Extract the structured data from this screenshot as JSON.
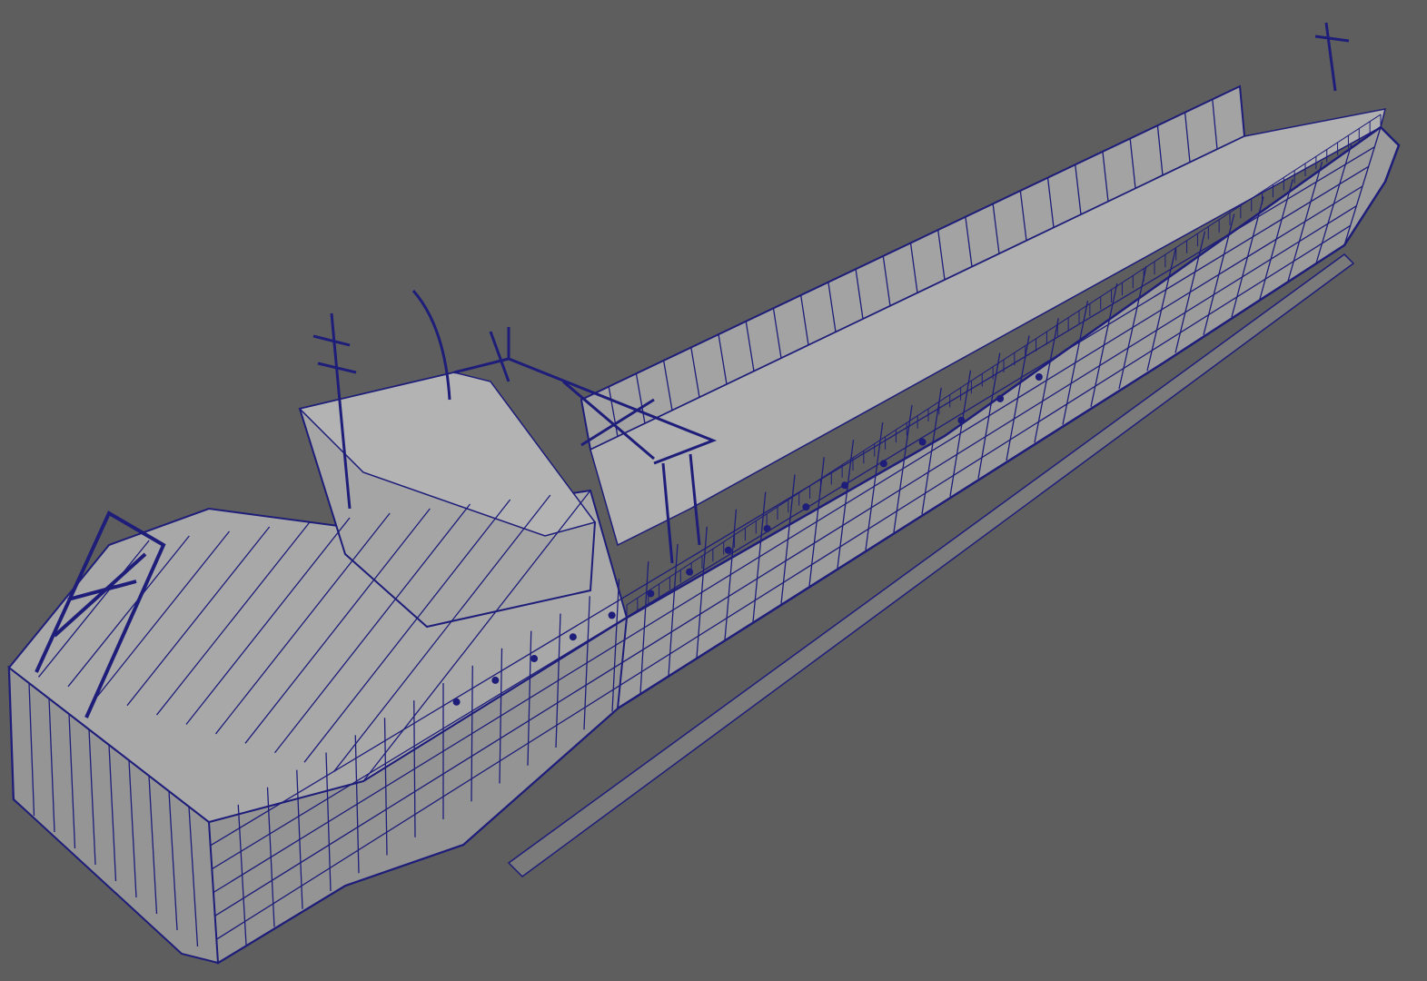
{
  "viewport": {
    "mode": "wireframe-on-shaded",
    "background_color": "#5e5e5e",
    "surface_color": "#9c9c9c",
    "wire_color": "#1e1e7a",
    "object": "cargo-vessel-model"
  }
}
